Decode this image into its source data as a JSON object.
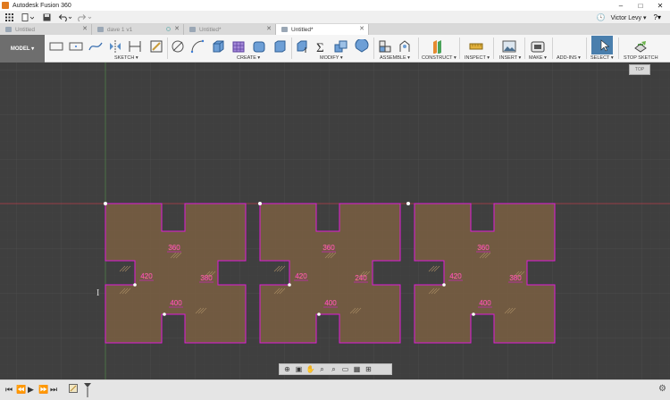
{
  "window": {
    "title": "Autodesk Fusion 360",
    "controls": [
      "–",
      "□",
      "✕"
    ]
  },
  "quick_access": {
    "user": "Victor Levy ▾",
    "help": "?▾",
    "clock_icon": "clock-icon"
  },
  "tabs": [
    {
      "label": "Untitled",
      "active": false
    },
    {
      "label": "dave 1 v1",
      "active": false
    },
    {
      "label": "Untitled*",
      "active": false
    },
    {
      "label": "Untitled*",
      "active": true
    }
  ],
  "workspace": {
    "label": "MODEL ▾"
  },
  "ribbon_groups": {
    "sketch": "SKETCH ▾",
    "create": "CREATE ▾",
    "modify": "MODIFY ▾",
    "assemble": "ASSEMBLE ▾",
    "construct": "CONSTRUCT ▾",
    "inspect": "INSPECT ▾",
    "insert": "INSERT ▾",
    "make": "MAKE ▾",
    "addins": "ADD-INS ▾",
    "select": "SELECT ▾",
    "stop_sketch": "STOP SKETCH"
  },
  "view_cube": {
    "label": "TOP"
  },
  "canvas": {
    "axis_color": "#c23b4b",
    "profile_fill": "#7a5f42",
    "sketch_line_color": "#e01ad8",
    "dimension_color": "#f2e21a",
    "shapes": [
      {
        "dims": {
          "top": "360",
          "left": "420",
          "right": "380",
          "bottom": "400"
        }
      },
      {
        "dims": {
          "top": "360",
          "left": "420",
          "right": "240",
          "bottom": "400"
        }
      },
      {
        "dims": {
          "top": "360",
          "left": "420",
          "right": "380",
          "bottom": "400"
        }
      }
    ]
  }
}
